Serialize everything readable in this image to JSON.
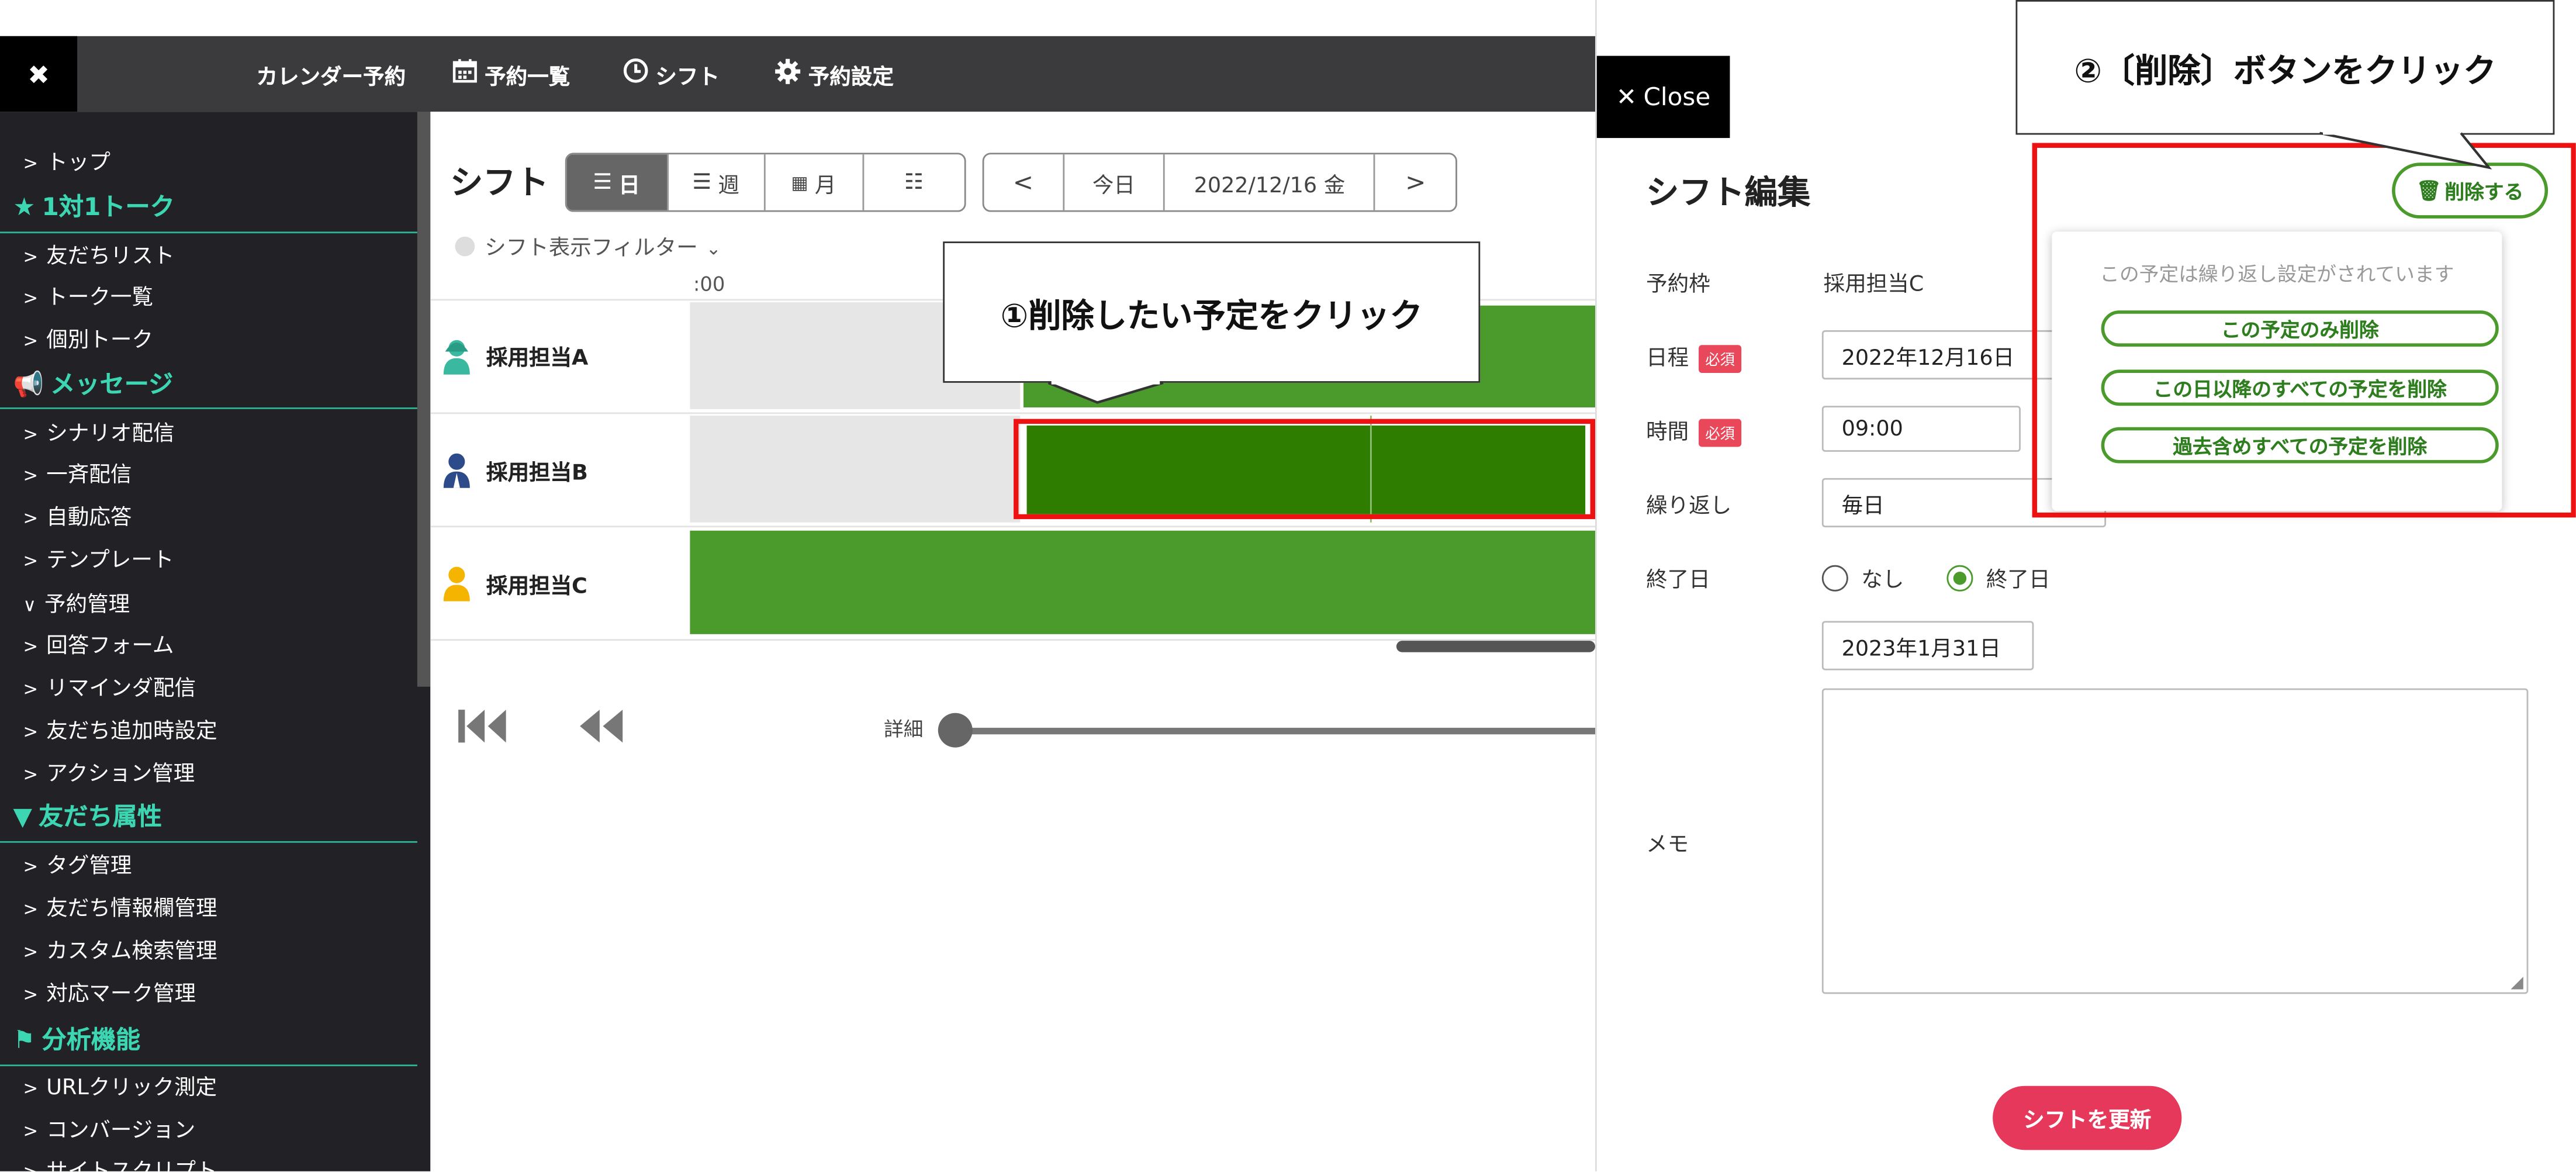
{
  "topbar": {
    "close_glyph": "✖",
    "nav": [
      {
        "label": "カレンダー予約",
        "icon": ""
      },
      {
        "label": "予約一覧",
        "icon": "calendar-icon"
      },
      {
        "label": "シフト",
        "icon": "clock-icon"
      },
      {
        "label": "予約設定",
        "icon": "gear-icon"
      }
    ]
  },
  "sidebar": {
    "top": "トップ",
    "section_talk": "1対1トーク",
    "talk_items": [
      "友だちリスト",
      "トーク一覧",
      "個別トーク"
    ],
    "section_message": "メッセージ",
    "message_items": [
      "シナリオ配信",
      "一斉配信",
      "自動応答",
      "テンプレート",
      "予約管理",
      "回答フォーム",
      "リマインダ配信",
      "友だち追加時設定",
      "アクション管理"
    ],
    "section_friend": "友だち属性",
    "friend_items": [
      "タグ管理",
      "友だち情報欄管理",
      "カスタム検索管理",
      "対応マーク管理"
    ],
    "section_analysis": "分析機能",
    "analysis_items": [
      "URLクリック測定",
      "コンバージョン",
      "サイトスクリプト"
    ]
  },
  "main": {
    "title": "シフト",
    "view_buttons": [
      "日",
      "週",
      "月",
      ""
    ],
    "nav_prev": "<",
    "today": "今日",
    "date": "2022/12/16 金",
    "nav_next": ">",
    "filter": "シフト表示フィルター",
    "time_label": ":00",
    "rows": [
      "採用担当A",
      "採用担当B",
      "採用担当C"
    ],
    "detail_label": "詳細"
  },
  "callouts": {
    "step1": "①削除したい予定をクリック",
    "step2": "②〔削除〕ボタンをクリック"
  },
  "panel": {
    "close": "Close",
    "title": "シフト編集",
    "delete_button": "削除する",
    "slot_label": "予約枠",
    "slot_value": "採用担当C",
    "date_label": "日程",
    "required": "必須",
    "date_value": "2022年12月16日",
    "time_label": "時間",
    "time_value": "09:00",
    "repeat_label": "繰り返し",
    "repeat_value": "毎日",
    "end_label": "終了日",
    "end_opt_none": "なし",
    "end_opt_date": "終了日",
    "end_date_value": "2023年1月31日",
    "memo_label": "メモ",
    "update_button": "シフトを更新",
    "popup_note": "この予定は繰り返し設定がされています",
    "popup_options": [
      "この予定のみ削除",
      "この日以降のすべての予定を削除",
      "過去含めすべての予定を削除"
    ]
  },
  "colors": {
    "accent_green": "#3dd6b2",
    "shift_green": "#4a9b2c",
    "shift_green_dark": "#2e7d00",
    "highlight_red": "#ee1111",
    "update_pink": "#e6385a"
  }
}
